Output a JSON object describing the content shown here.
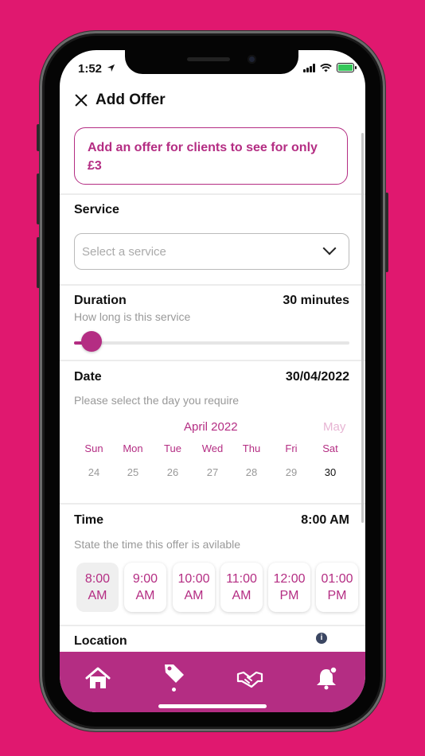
{
  "status_bar": {
    "time": "1:52"
  },
  "header": {
    "title": "Add Offer"
  },
  "banner": {
    "text": "Add an offer for clients to see for only £3"
  },
  "service": {
    "label": "Service",
    "placeholder": "Select a service"
  },
  "duration": {
    "label": "Duration",
    "value": "30 minutes",
    "hint": "How long is this service",
    "slider_fraction": 0.07
  },
  "date": {
    "label": "Date",
    "value": "30/04/2022",
    "hint": "Please select the day you require",
    "month": "April 2022",
    "next_month": "May",
    "weekdays": [
      "Sun",
      "Mon",
      "Tue",
      "Wed",
      "Thu",
      "Fri",
      "Sat"
    ],
    "days": [
      "24",
      "25",
      "26",
      "27",
      "28",
      "29",
      "30"
    ],
    "selected_day": "30"
  },
  "time": {
    "label": "Time",
    "value": "8:00 AM",
    "hint": "State the time this offer is avilable",
    "slots": [
      {
        "time": "8:00",
        "period": "AM",
        "selected": true
      },
      {
        "time": "9:00",
        "period": "AM",
        "selected": false
      },
      {
        "time": "10:00",
        "period": "AM",
        "selected": false
      },
      {
        "time": "11:00",
        "period": "AM",
        "selected": false
      },
      {
        "time": "12:00",
        "period": "PM",
        "selected": false
      },
      {
        "time": "01:00",
        "period": "PM",
        "selected": false
      }
    ]
  },
  "location": {
    "label": "Location"
  },
  "tabbar": {
    "icons": [
      "home-icon",
      "tag-icon",
      "handshake-icon",
      "bell-icon"
    ],
    "active": "tag-icon"
  },
  "colors": {
    "background": "#e0186f",
    "accent": "#b42d83"
  }
}
